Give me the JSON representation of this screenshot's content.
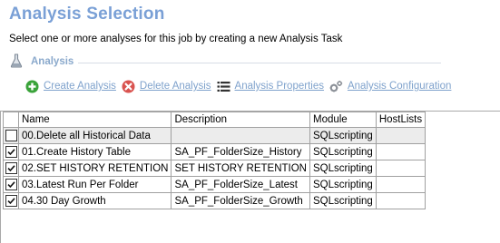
{
  "header": {
    "title": "Analysis Selection",
    "subtitle": "Select one or more analyses for this job by creating a new Analysis Task"
  },
  "section": {
    "label": "Analysis",
    "icon": "flask-icon"
  },
  "toolbar": {
    "create_label": "Create Analysis",
    "delete_label": "Delete Analysis",
    "properties_label": "Analysis Properties",
    "configuration_label": "Analysis Configuration"
  },
  "table": {
    "columns": [
      "",
      "Name",
      "Description",
      "Module",
      "HostLists"
    ],
    "rows": [
      {
        "checked": false,
        "name": "00.Delete all Historical Data",
        "description": "",
        "module": "SQLscripting",
        "hostlists": ""
      },
      {
        "checked": true,
        "name": "01.Create History Table",
        "description": "SA_PF_FolderSize_History",
        "module": "SQLscripting",
        "hostlists": ""
      },
      {
        "checked": true,
        "name": "02.SET HISTORY RETENTION",
        "description": "SET HISTORY RETENTION",
        "module": "SQLscripting",
        "hostlists": ""
      },
      {
        "checked": true,
        "name": "03.Latest Run Per Folder",
        "description": "SA_PF_FolderSize_Latest",
        "module": "SQLscripting",
        "hostlists": ""
      },
      {
        "checked": true,
        "name": "04.30 Day Growth",
        "description": "SA_PF_FolderSize_Growth",
        "module": "SQLscripting",
        "hostlists": ""
      }
    ]
  },
  "colors": {
    "title": "#7aa0d6",
    "link": "#7fa2cc",
    "create_icon": "#3aa33a",
    "delete_icon": "#d9534f"
  }
}
